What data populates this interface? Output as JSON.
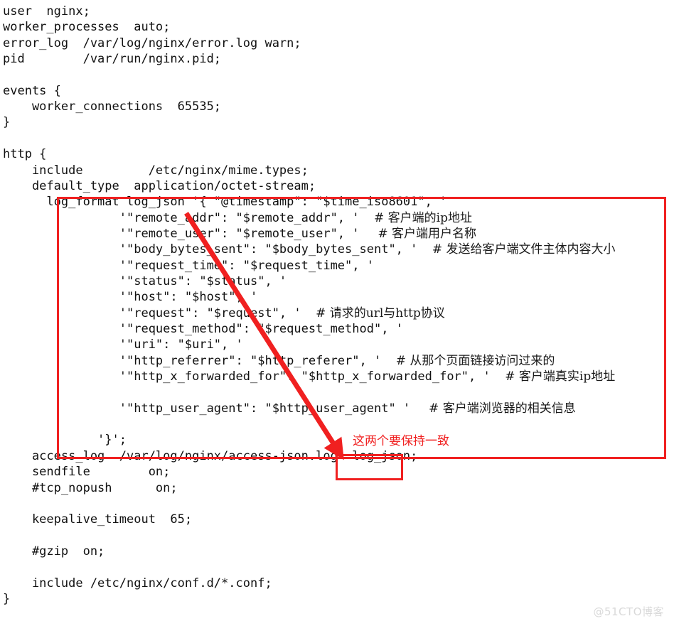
{
  "document": {
    "type": "nginx-configuration-file",
    "watermark": "@51CTO博客"
  },
  "code": {
    "lines": [
      {
        "text": "user  nginx;"
      },
      {
        "text": "worker_processes  auto;"
      },
      {
        "text": "error_log  /var/log/nginx/error.log warn;"
      },
      {
        "text": "pid        /var/run/nginx.pid;"
      },
      {
        "text": ""
      },
      {
        "text": "events {"
      },
      {
        "text": "    worker_connections  65535;"
      },
      {
        "text": "}"
      },
      {
        "text": ""
      },
      {
        "text": "http {"
      },
      {
        "text": "    include         /etc/nginx/mime.types;"
      },
      {
        "text": "    default_type  application/octet-stream;"
      },
      {
        "text": "      log_format log_json '{ \"@timestamp\": \"$time_iso8601\", '"
      },
      {
        "text": "                '\"remote_addr\": \"$remote_addr\", '",
        "comment": "# 客户端的ip地址"
      },
      {
        "text": "                '\"remote_user\": \"$remote_user\", '",
        "comment": " # 客户端用户名称"
      },
      {
        "text": "                '\"body_bytes_sent\": \"$body_bytes_sent\", '",
        "comment": "# 发送给客户端文件主体内容大小"
      },
      {
        "text": "                '\"request_time\": \"$request_time\", '"
      },
      {
        "text": "                '\"status\": \"$status\", '"
      },
      {
        "text": "                '\"host\": \"$host\", '"
      },
      {
        "text": "                '\"request\": \"$request\", '",
        "comment": "# 请求的url与http协议"
      },
      {
        "text": "                '\"request_method\": \"$request_method\", '"
      },
      {
        "text": "                '\"uri\": \"$uri\", '"
      },
      {
        "text": "                '\"http_referrer\": \"$http_referer\", '",
        "comment": "# 从那个页面链接访问过来的"
      },
      {
        "text": "                '\"http_x_forwarded_for\": \"$http_x_forwarded_for\", '",
        "comment": "# 客户端真实ip地址"
      },
      {
        "text": ""
      },
      {
        "text": "                '\"http_user_agent\": \"$http_user_agent\" '",
        "comment": " # 客户端浏览器的相关信息"
      },
      {
        "text": ""
      },
      {
        "text": "             '}';"
      },
      {
        "text": "    access_log  /var/log/nginx/access-json.log  log_json;"
      },
      {
        "text": "    sendfile        on;"
      },
      {
        "text": "    #tcp_nopush      on;"
      },
      {
        "text": ""
      },
      {
        "text": "    keepalive_timeout  65;"
      },
      {
        "text": ""
      },
      {
        "text": "    #gzip  on;"
      },
      {
        "text": ""
      },
      {
        "text": "    include /etc/nginx/conf.d/*.conf;"
      },
      {
        "text": "}"
      }
    ]
  },
  "annotations": {
    "color": "#f02020",
    "logformat_box_label": "log_format log_json block highlight",
    "logjson_box_label": "log_json reference highlight",
    "arrow_label": "arrow from log_format name to access_log reference",
    "consistency_note": "这两个要保持一致"
  }
}
